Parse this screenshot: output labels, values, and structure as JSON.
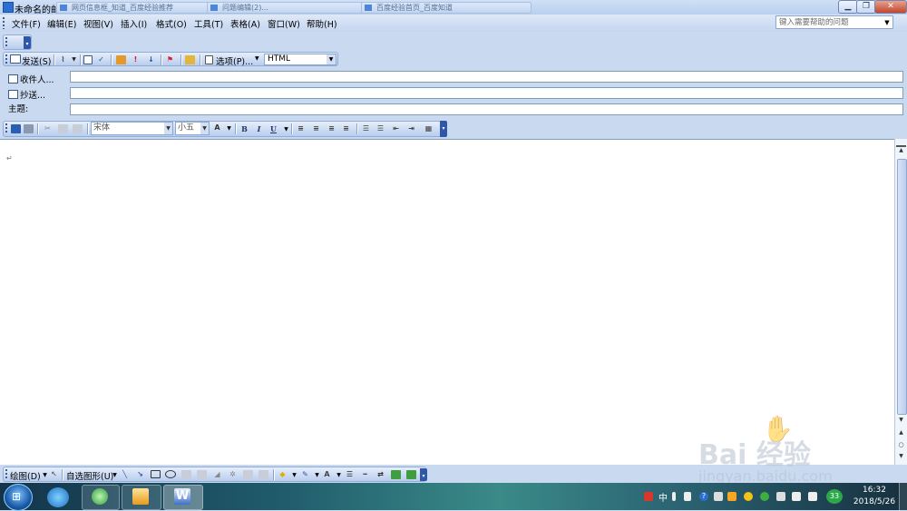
{
  "window": {
    "title": "未命名的邮件",
    "bg_tabs": [
      "网页信息框_知道_百度经验推荐",
      "问题编辑(2)...",
      "百度经验首页_百度知道"
    ],
    "minimize_icon": "minimize-icon",
    "restore_icon": "restore-icon",
    "close_icon": "close-icon"
  },
  "menu": {
    "items": [
      "文件(F)",
      "编辑(E)",
      "视图(V)",
      "插入(I)",
      "格式(O)",
      "工具(T)",
      "表格(A)",
      "窗口(W)",
      "帮助(H)"
    ],
    "help_placeholder": "键入需要帮助的问题"
  },
  "mail_toolbar": {
    "send_label": "发送(S)",
    "options_label": "选项(P)...",
    "format_value": "HTML"
  },
  "header": {
    "to_label": "收件人...",
    "cc_label": "抄送...",
    "subject_label": "主题:",
    "to_value": "",
    "cc_value": "",
    "subject_value": ""
  },
  "format_toolbar": {
    "font_name": "宋体",
    "font_size": "小五",
    "bold": "B",
    "italic": "I",
    "underline": "U"
  },
  "document": {
    "paragraph_mark": "↵"
  },
  "drawing_toolbar": {
    "draw_label": "绘图(D)",
    "autoshapes_label": "自选图形(U)"
  },
  "taskbar": {
    "ime_label": "中",
    "notify_count": "33",
    "time": "16:32",
    "date": "2018/5/26"
  },
  "watermark": {
    "brand": "Bai 经验",
    "url": "jingyan.baidu.com"
  },
  "colors": {
    "accent": "#2d57a8",
    "toolbar_bg": "#c9d9f0",
    "close_red": "#c2452c"
  }
}
